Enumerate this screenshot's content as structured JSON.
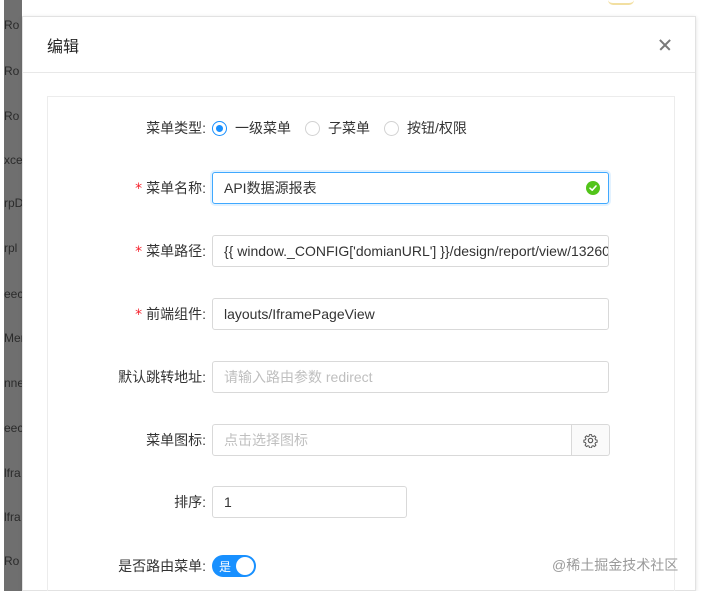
{
  "background": {
    "strip_fragments": [
      "Ro",
      "Ro",
      "Ro",
      "xce",
      "rpD",
      "rpl",
      "eec",
      "Mer",
      "nne",
      "eec",
      "lfra",
      "lfra",
      "Ro"
    ]
  },
  "modal": {
    "title": "编辑"
  },
  "form": {
    "menu_type": {
      "label": "菜单类型:",
      "options": [
        "一级菜单",
        "子菜单",
        "按钮/权限"
      ],
      "selected": "一级菜单"
    },
    "menu_name": {
      "label": "菜单名称:",
      "required": "*",
      "value": "API数据源报表"
    },
    "menu_path": {
      "label": "菜单路径:",
      "required": "*",
      "value": "{{ window._CONFIG['domianURL'] }}/design/report/view/13260"
    },
    "frontend_component": {
      "label": "前端组件:",
      "required": "*",
      "value": "layouts/IframePageView"
    },
    "redirect": {
      "label": "默认跳转地址:",
      "placeholder": "请输入路由参数 redirect"
    },
    "menu_icon": {
      "label": "菜单图标:",
      "placeholder": "点击选择图标"
    },
    "sort": {
      "label": "排序:",
      "value": "1"
    },
    "is_route": {
      "label": "是否路由菜单:",
      "switch_text": "是",
      "on": true
    }
  },
  "watermark": "@稀土掘金技术社区",
  "colors": {
    "primary": "#1890ff",
    "required": "#f5222d",
    "success": "#52c41a",
    "border": "#d9d9d9"
  }
}
